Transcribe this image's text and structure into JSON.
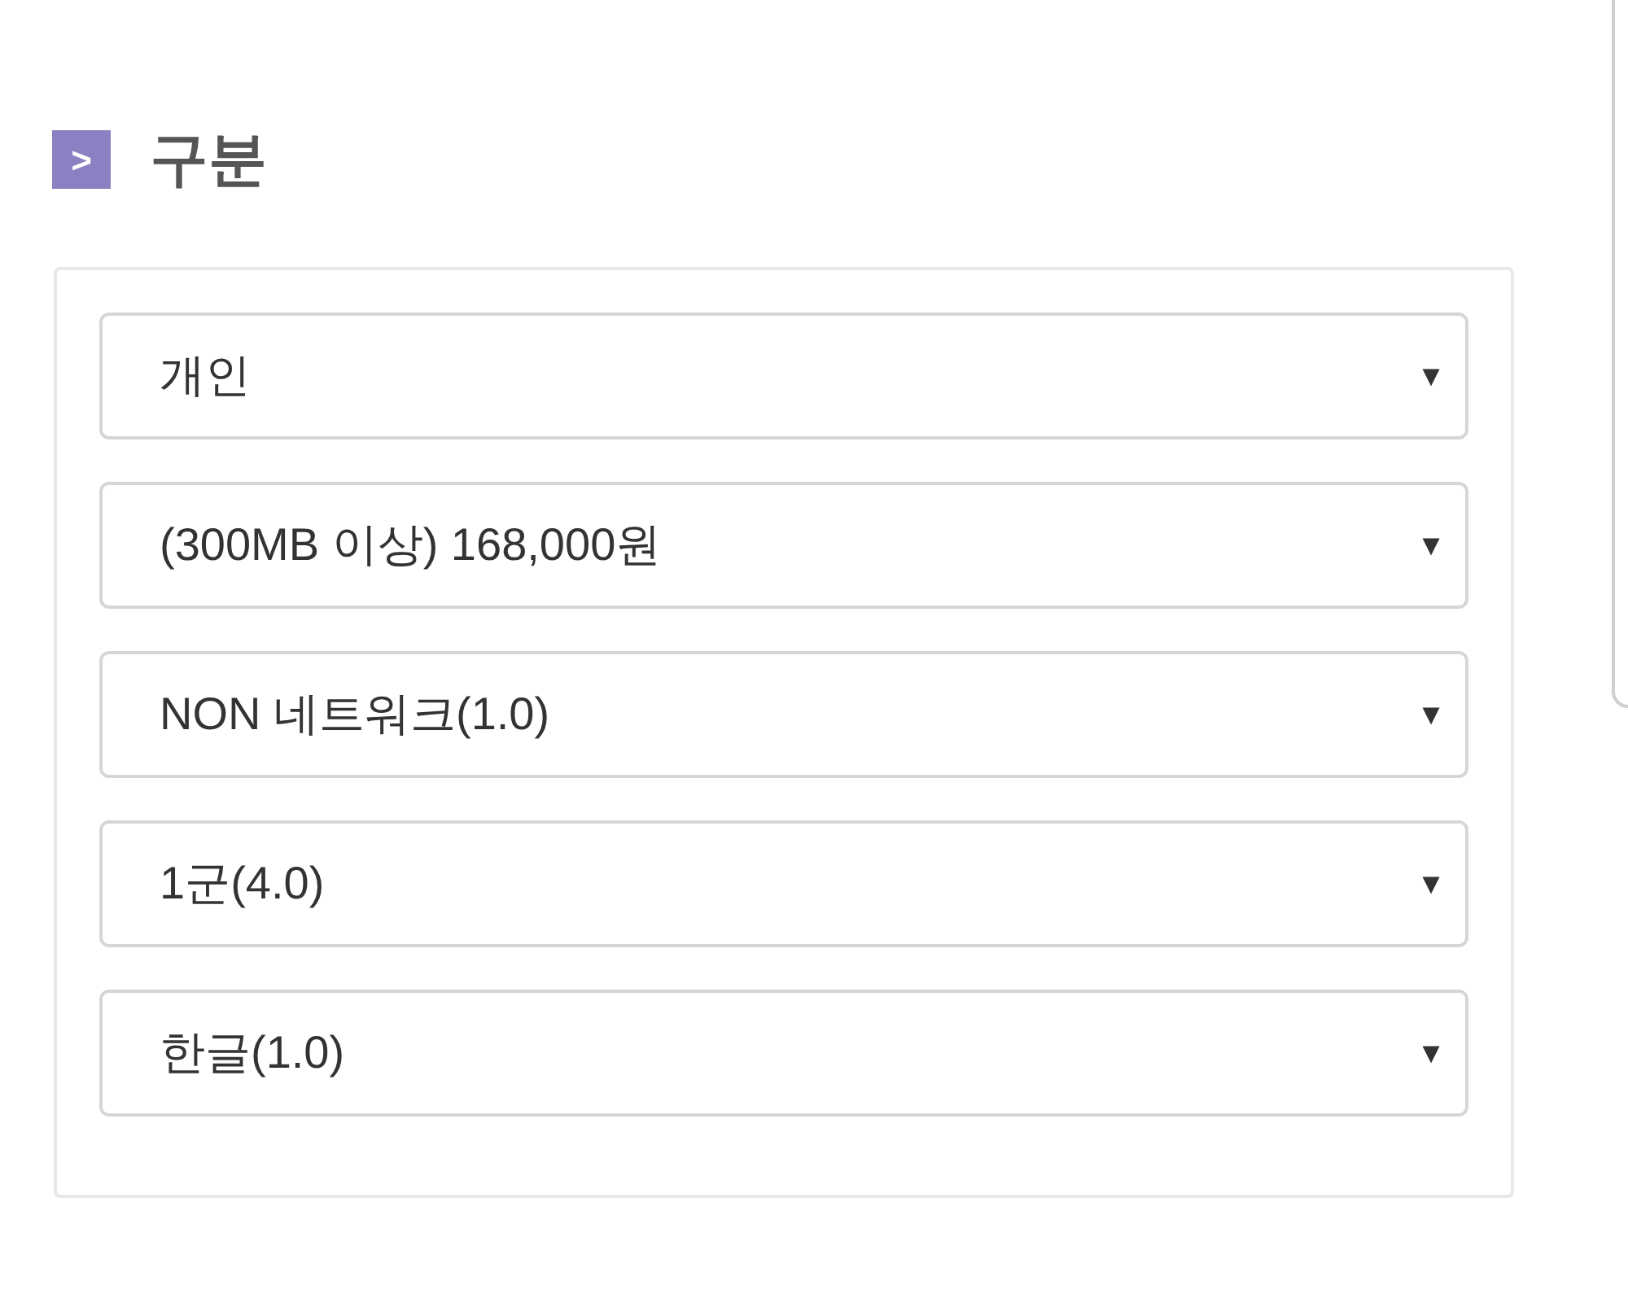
{
  "section": {
    "icon": ">",
    "title": "구분"
  },
  "selects": [
    {
      "value": "개인",
      "caret": "▼"
    },
    {
      "value": "(300MB 이상) 168,000원",
      "caret": "▼"
    },
    {
      "value": "NON 네트워크(1.0)",
      "caret": "▼"
    },
    {
      "value": "1군(4.0)",
      "caret": "▼"
    },
    {
      "value": "한글(1.0)",
      "caret": "▼"
    }
  ]
}
